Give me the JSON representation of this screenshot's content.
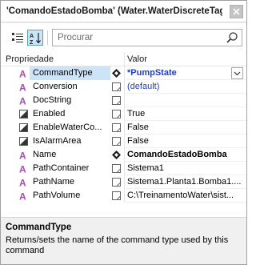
{
  "window": {
    "title": "'ComandoEstadoBomba' (Water.WaterDiscreteTag)"
  },
  "toolbar": {
    "categorized_icon": "categorized-view-icon",
    "alphabetical_icon": "alphabetical-sort-icon",
    "search_placeholder": "Procurar"
  },
  "grid": {
    "header_property": "Propriedade",
    "header_value": "Valor",
    "rows": [
      {
        "name": "CommandType",
        "value": "*PumpState",
        "icon": "property-icon",
        "state": "diamond-icon"
      },
      {
        "name": "Conversion",
        "value": "(default)",
        "icon": "property-icon",
        "state": "edit-box-icon"
      },
      {
        "name": "DocString",
        "value": "",
        "icon": "property-icon",
        "state": "edit-box-icon"
      },
      {
        "name": "Enabled",
        "value": "True",
        "icon": "boolean-icon",
        "state": "edit-box-icon"
      },
      {
        "name": "EnableWaterCo...",
        "value": "False",
        "icon": "boolean-icon",
        "state": "edit-box-icon"
      },
      {
        "name": "IsAlarmArea",
        "value": "False",
        "icon": "boolean-icon",
        "state": "edit-box-icon"
      },
      {
        "name": "Name",
        "value": "ComandoEstadoBomba",
        "icon": "property-icon",
        "state": "diamond-icon"
      },
      {
        "name": "PathContainer",
        "value": "Sistema1",
        "icon": "property-icon",
        "state": "edit-box-icon"
      },
      {
        "name": "PathName",
        "value": "Sistema1.Planta1.Bomba1....",
        "icon": "property-icon",
        "state": "edit-box-icon"
      },
      {
        "name": "PathVolume",
        "value": "C:\\TreinamentoWater\\sist...",
        "icon": "property-icon",
        "state": "edit-box-icon"
      }
    ]
  },
  "description": {
    "title": "CommandType",
    "text": "Returns/sets the name of the command type used by this command"
  },
  "colors": {
    "selection": "#cce4f7",
    "property_icon": "#b146c2",
    "value_link": "#1e3fc4"
  }
}
